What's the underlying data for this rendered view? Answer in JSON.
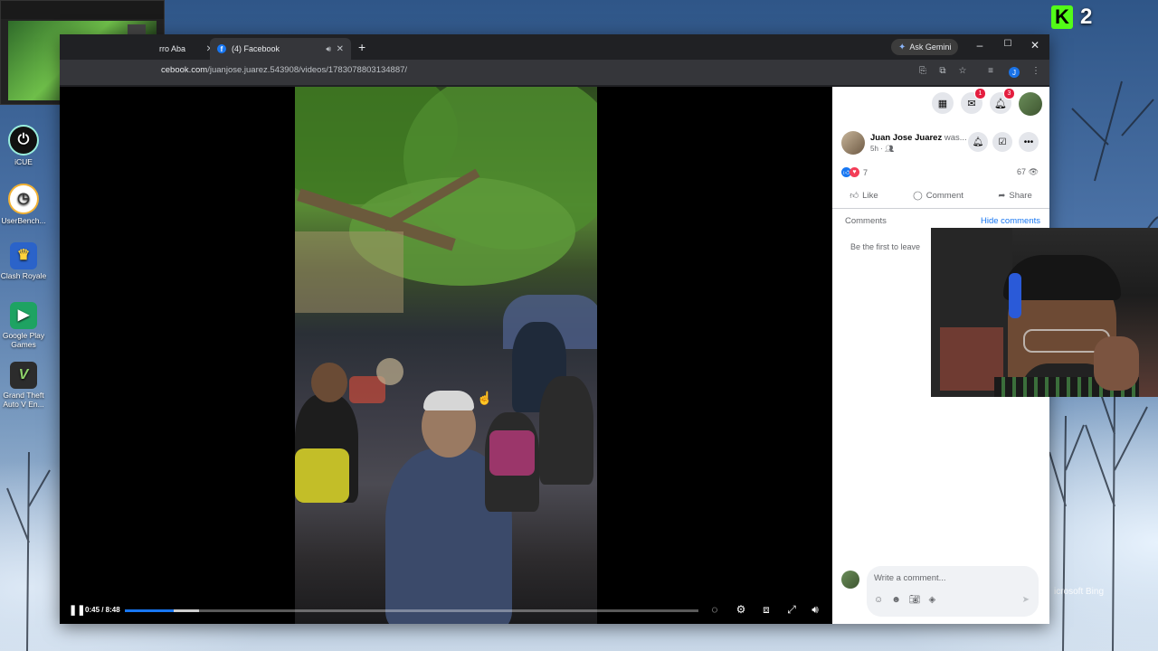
{
  "desktop": {
    "icons": [
      {
        "label": "iCUE",
        "glyph": "⏻",
        "color": "#1b1b1b"
      },
      {
        "label": "UserBench...",
        "glyph": "◷",
        "color": "#f3b233"
      },
      {
        "label": "Clash Royale",
        "glyph": "♛",
        "color": "#2b63c9"
      },
      {
        "label": "Google Play Games",
        "glyph": "▶",
        "color": "#1ea362"
      },
      {
        "label": "Grand Theft Auto V En...",
        "glyph": "V",
        "color": "#3a3a3a"
      }
    ],
    "kick_count": "2",
    "kick_letter": "K",
    "bing_watermark": "icrosoft Bing"
  },
  "browser": {
    "tabs": [
      {
        "label": "rro Aba"
      },
      {
        "label": "(4) Facebook",
        "favicon": "f"
      }
    ],
    "new_tab": "+",
    "ask_gemini": "Ask Gemini",
    "window_controls": {
      "minimize": "–",
      "maximize": "☐",
      "close": "✕"
    },
    "url_domain": "cebook.com",
    "url_path": "/juanjose.juarez.543908/videos/1783078803134887/",
    "profile_letter": "J"
  },
  "video": {
    "time": "0:45 / 8:48",
    "progress_fraction": 0.085,
    "buffer_fraction": 0.13
  },
  "facebook": {
    "badges": {
      "messenger": "1",
      "notifications": "3"
    },
    "post": {
      "author": "Juan Jose Juarez",
      "author_suffix": "was...",
      "time": "5h ·",
      "reaction_count": "7",
      "views": "67"
    },
    "actions": {
      "like": "Like",
      "comment": "Comment",
      "share": "Share"
    },
    "comments_label": "Comments",
    "hide_comments": "Hide comments",
    "empty_text": "Be the first to leave",
    "write_placeholder": "Write a comment..."
  }
}
